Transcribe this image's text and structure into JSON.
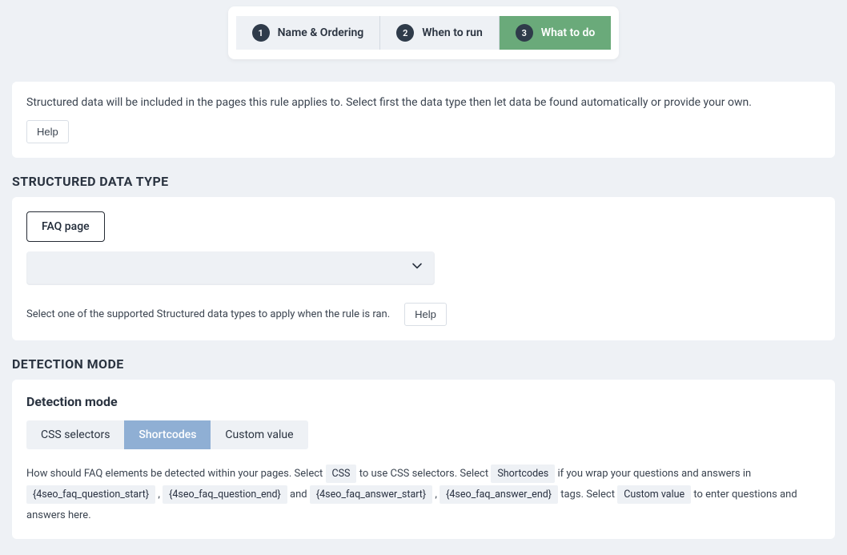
{
  "stepper": {
    "steps": [
      {
        "num": "1",
        "label": "Name & Ordering"
      },
      {
        "num": "2",
        "label": "When to run"
      },
      {
        "num": "3",
        "label": "What to do"
      }
    ]
  },
  "intro": {
    "text": "Structured data will be included in the pages this rule applies to. Select first the data type then let data be found automatically or provide your own.",
    "help": "Help"
  },
  "structured_type": {
    "heading": "STRUCTURED DATA TYPE",
    "badge": "FAQ page",
    "hint": "Select one of the supported Structured data types to apply when the rule is ran.",
    "help": "Help"
  },
  "detection": {
    "heading": "DETECTION MODE",
    "sub": "Detection mode",
    "tabs": {
      "css": "CSS selectors",
      "short": "Shortcodes",
      "custom": "Custom value"
    },
    "explainer": {
      "t1": "How should FAQ elements be detected within your pages. Select",
      "c1": "CSS",
      "t2": "to use CSS selectors. Select",
      "c2": "Shortcodes",
      "t3": "if you wrap your questions and answers in",
      "c3": "{4seo_faq_question_start}",
      "t4": ",",
      "c4": "{4seo_faq_question_end}",
      "t5": "and",
      "c5": "{4seo_faq_answer_start}",
      "t6": ",",
      "c6": "{4seo_faq_answer_end}",
      "t7": "tags. Select",
      "c7": "Custom value",
      "t8": "to enter questions and answers here."
    }
  }
}
